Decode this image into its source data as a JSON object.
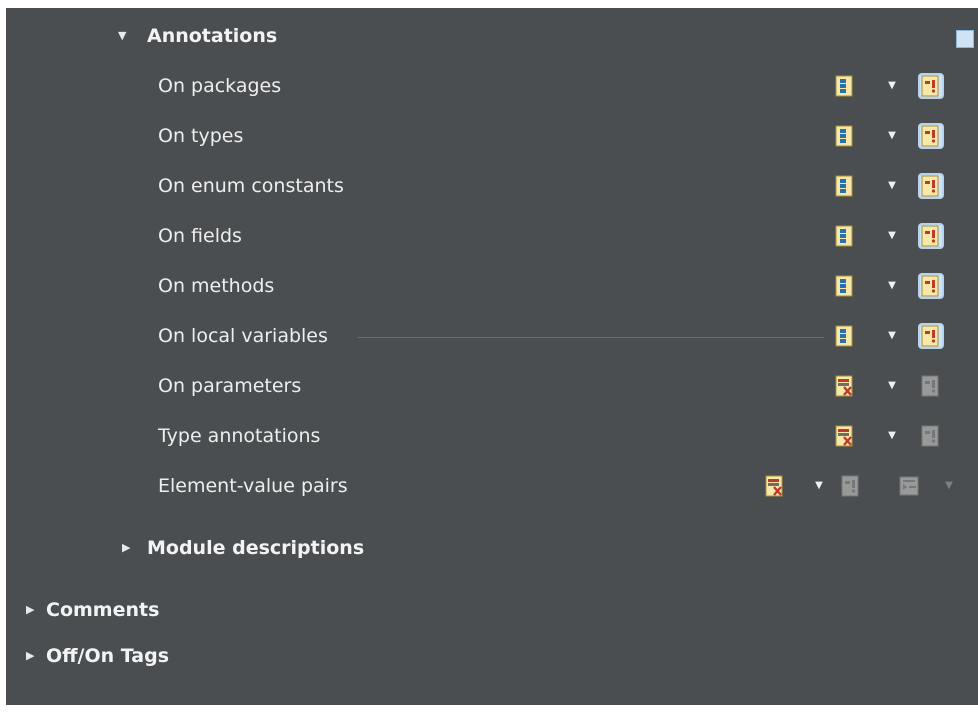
{
  "section": {
    "annotations_label": "Annotations",
    "module_descriptions_label": "Module descriptions"
  },
  "rows": [
    {
      "label": "On packages"
    },
    {
      "label": "On types"
    },
    {
      "label": "On enum constants"
    },
    {
      "label": "On fields"
    },
    {
      "label": "On methods"
    },
    {
      "label": "On local variables"
    },
    {
      "label": "On parameters"
    },
    {
      "label": "Type annotations"
    },
    {
      "label": "Element-value pairs"
    }
  ],
  "groups": {
    "comments_label": "Comments",
    "off_on_tags_label": "Off/On Tags"
  },
  "icons": {
    "wrap": "wrap-each-element-icon",
    "do_not_wrap": "do-not-wrap-icon",
    "force_split": "force-split-icon",
    "indent": "indent-icon",
    "dropdown": "chevron-down-icon",
    "expanded": "triangle-down-icon",
    "collapsed": "triangle-right-icon"
  },
  "colors": {
    "panel_bg": "#4b4e50",
    "text": "#eceeef",
    "highlight": "#cfe3f4"
  }
}
